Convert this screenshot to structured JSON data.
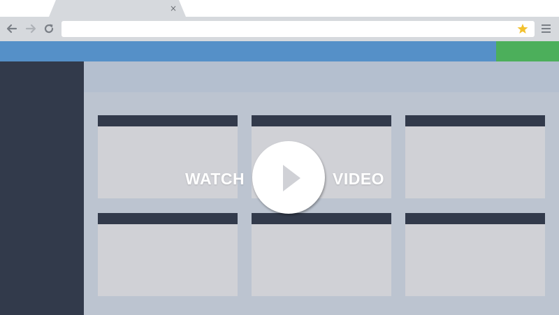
{
  "browser": {
    "tab": {
      "close_glyph": "×"
    },
    "toolbar": {
      "back_icon": "back-arrow-icon",
      "forward_icon": "forward-arrow-icon",
      "reload_icon": "reload-icon",
      "address_value": "",
      "bookmark_icon": "star-icon",
      "menu_icon": "hamburger-menu-icon"
    }
  },
  "colors": {
    "header_blue": "#5590c8",
    "action_green": "#4caf5b",
    "sidebar_dark": "#323a4b",
    "content_bg": "#bcc4d0",
    "card_bg": "#d0d1d6",
    "star_yellow": "#f2c12e"
  },
  "overlay": {
    "watch_label": "WATCH",
    "video_label": "VIDEO",
    "play_icon": "play-icon"
  },
  "cards": {
    "count": 6
  }
}
